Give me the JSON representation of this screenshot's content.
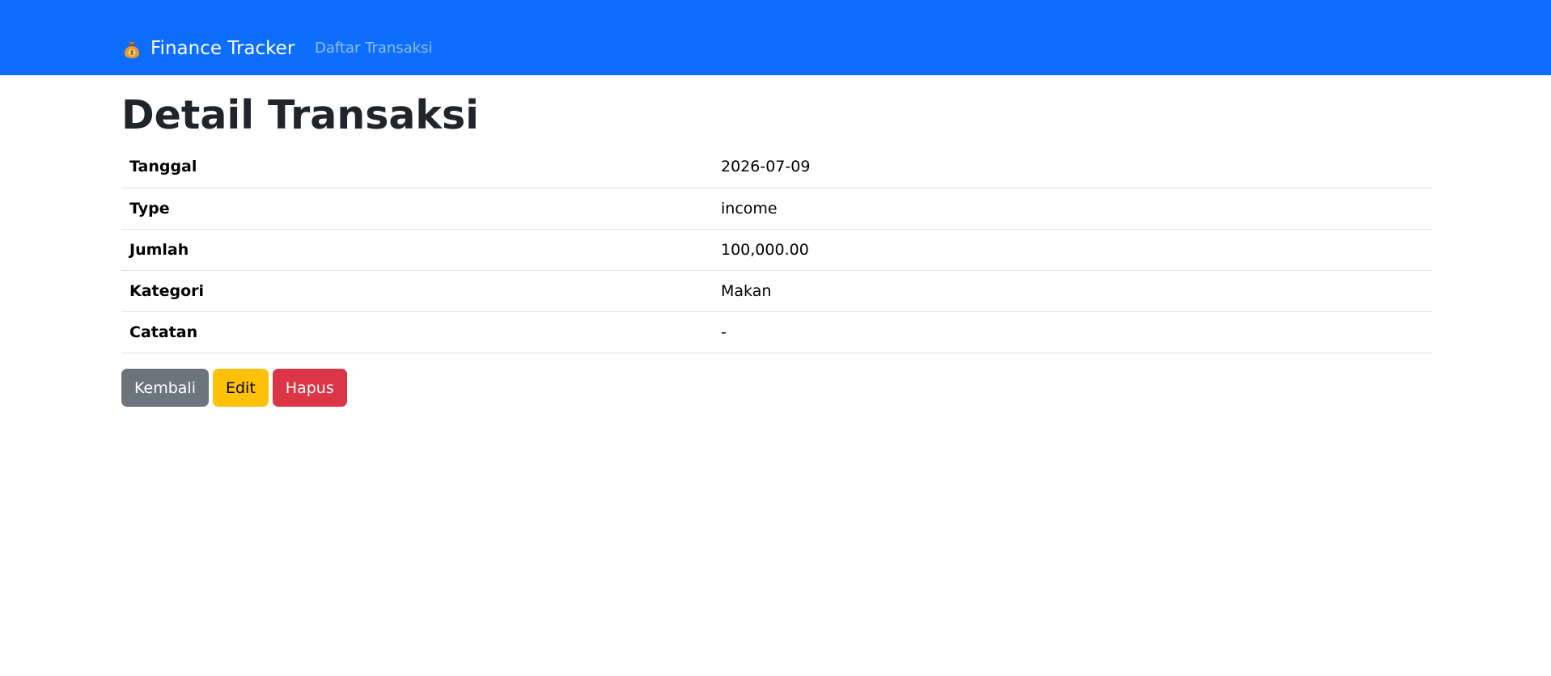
{
  "navbar": {
    "brand_label": "Finance Tracker",
    "brand_icon": "money-bag-icon",
    "link_label": "Daftar Transaksi",
    "background_color": "#0d6efd"
  },
  "page": {
    "title": "Detail Transaksi"
  },
  "details": [
    {
      "label": "Tanggal",
      "value": "2026-07-09"
    },
    {
      "label": "Type",
      "value": "income"
    },
    {
      "label": "Jumlah",
      "value": "100,000.00"
    },
    {
      "label": "Kategori",
      "value": "Makan"
    },
    {
      "label": "Catatan",
      "value": "-"
    }
  ],
  "actions": {
    "back_label": "Kembali",
    "edit_label": "Edit",
    "delete_label": "Hapus",
    "back_color": "#6c757d",
    "edit_color": "#ffc107",
    "delete_color": "#dc3545"
  }
}
